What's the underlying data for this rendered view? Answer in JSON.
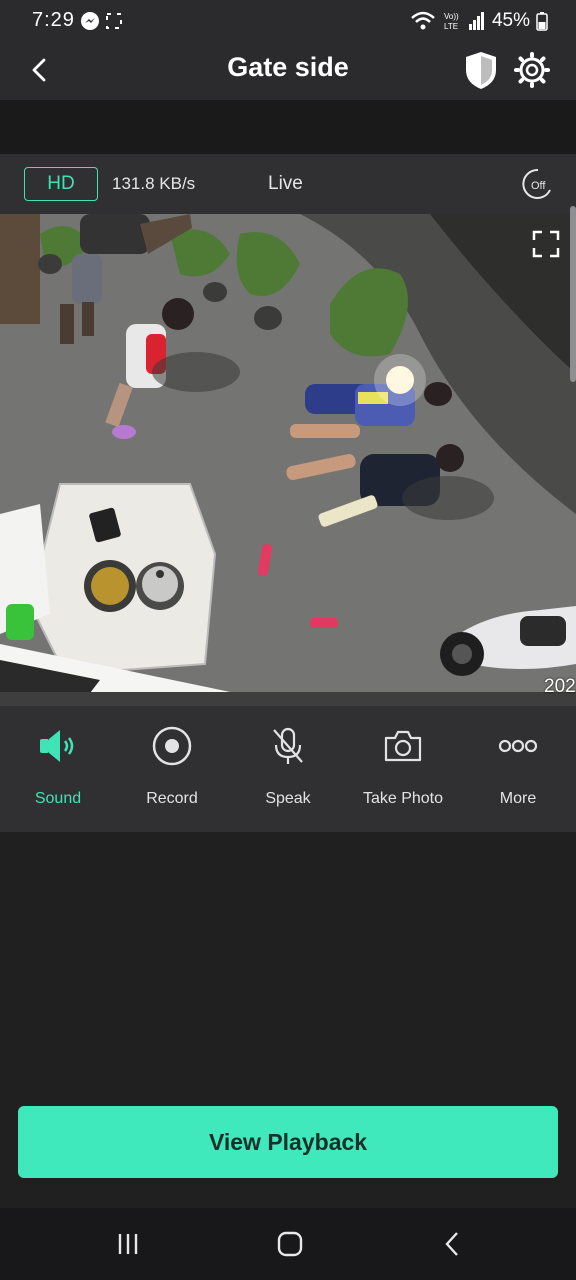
{
  "status_bar": {
    "time": "7:29",
    "battery": "45%",
    "icons": [
      "messenger-icon",
      "screenshot-icon",
      "wifi-icon",
      "volte-icon",
      "signal-icon",
      "battery-icon"
    ]
  },
  "header": {
    "title": "Gate side",
    "icons": [
      "back-arrow-icon",
      "shield-icon",
      "gear-icon"
    ]
  },
  "stream_info": {
    "quality": "HD",
    "bitrate": "131.8 KB/s",
    "mode": "Live",
    "night_vision_label": "Off"
  },
  "video": {
    "timestamp_partial": "202",
    "icons": [
      "fullscreen-icon"
    ]
  },
  "toolbar": {
    "items": [
      {
        "label": "Sound",
        "icon": "speaker-icon",
        "active": true
      },
      {
        "label": "Record",
        "icon": "record-icon",
        "active": false
      },
      {
        "label": "Speak",
        "icon": "mic-muted-icon",
        "active": false
      },
      {
        "label": "Take Photo",
        "icon": "camera-icon",
        "active": false
      },
      {
        "label": "More",
        "icon": "more-dots-icon",
        "active": false
      }
    ]
  },
  "playback_button": "View Playback",
  "nav_bar": {
    "icons": [
      "recents-icon",
      "home-icon",
      "back-icon"
    ]
  },
  "colors": {
    "accent": "#3fe3b6",
    "button": "#3fe9bb",
    "background": "#202021",
    "panel": "#303032"
  }
}
